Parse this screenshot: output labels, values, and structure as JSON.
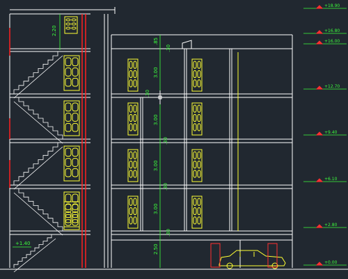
{
  "levels": [
    {
      "text": "+18.90"
    },
    {
      "text": "+16.80"
    },
    {
      "text": "+16.00"
    },
    {
      "text": "+12.70"
    },
    {
      "text": "+9.40"
    },
    {
      "text": "+6.10"
    },
    {
      "text": "+2.80"
    },
    {
      "text": "+0.00"
    }
  ],
  "stair_level": "+1.40",
  "dims": {
    "stair_top": "2.20",
    "parapet": ".85",
    "slab1": ".30",
    "floor4": "3.00",
    "slab2": ".30",
    "floor3": "3.00",
    "slab3": ".30",
    "floor2": "3.00",
    "slab4": ".30",
    "floor1": "3.00",
    "slab5": ".30",
    "ground": "2.50"
  },
  "colors": {
    "background": "#212830",
    "structure": "#ffffff",
    "door": "#ffff33",
    "dimension": "#3cff3c",
    "level_marker": "#ff3030",
    "wall_hatch": "#ff2020",
    "car": "#ffff33"
  }
}
